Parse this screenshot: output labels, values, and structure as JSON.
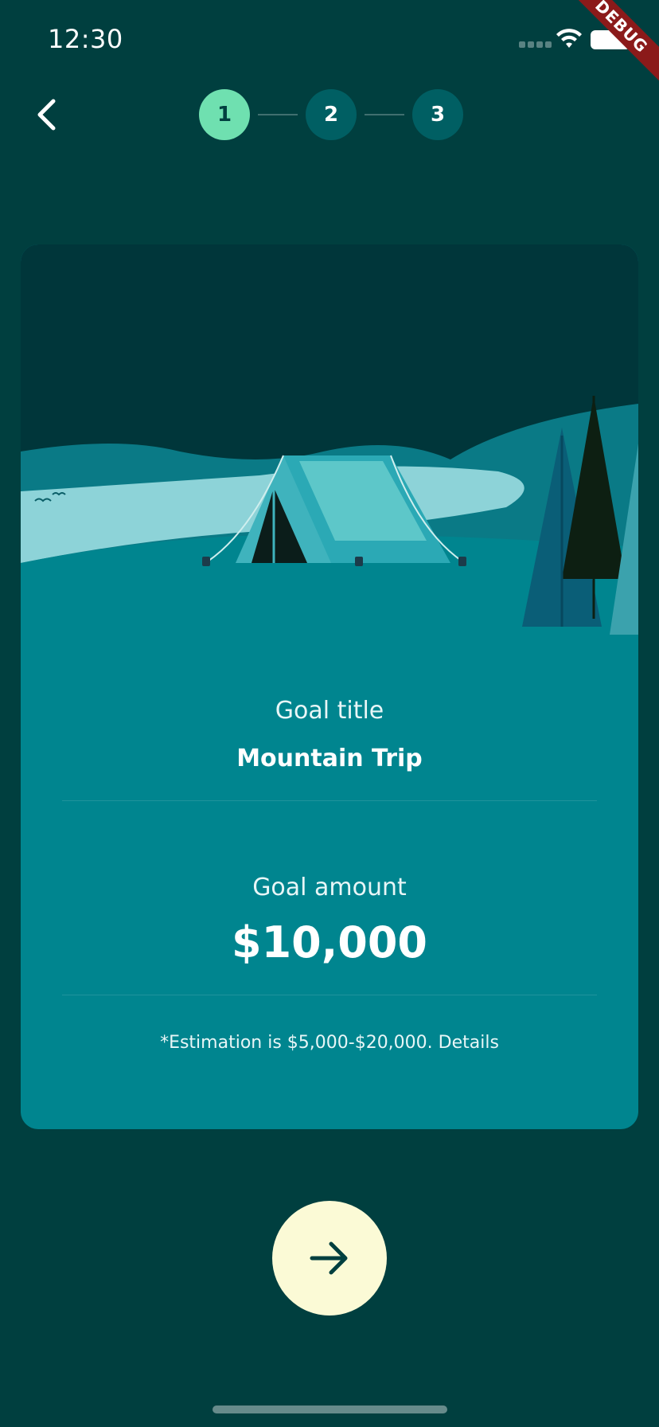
{
  "status_bar": {
    "time": "12:30",
    "debug_label": "DEBUG"
  },
  "header": {
    "back_icon": "chevron-left-icon",
    "steps": [
      {
        "label": "1",
        "active": true
      },
      {
        "label": "2",
        "active": false
      },
      {
        "label": "3",
        "active": false
      }
    ]
  },
  "card": {
    "goal_title_label": "Goal title",
    "goal_title_value": "Mountain Trip",
    "goal_amount_label": "Goal amount",
    "goal_amount_value": "$10,000",
    "estimation_text": "*Estimation is $5,000-$20,000. Details"
  },
  "next_button": {
    "icon": "arrow-right-icon"
  },
  "colors": {
    "background": "#003f3f",
    "card": "#00858f",
    "step_active": "#6fe0b0",
    "step_inactive": "#005f63",
    "next_button": "#fbfad6"
  }
}
